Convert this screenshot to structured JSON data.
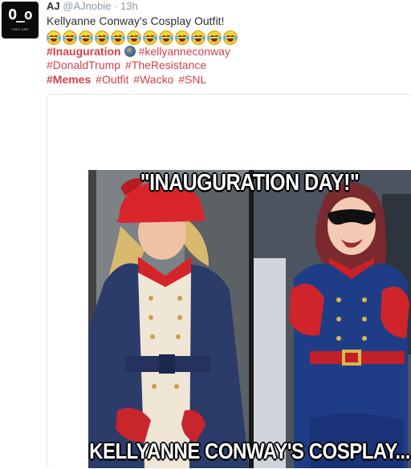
{
  "user": {
    "name": "AJ",
    "handle": "@AJnobie",
    "separator": "·",
    "time": "13h",
    "avatar": {
      "face": "O_o",
      "tiny_text": "THEY ARE"
    }
  },
  "tweet": {
    "text": "Kellyanne Conway's Cosplay Outfit!",
    "emoji_count": 12,
    "emoji_name": "face-with-tears-of-joy",
    "hashtag_lines": [
      [
        {
          "text": "#Inauguration",
          "bold": true
        },
        {
          "text": "#kellyanneconway",
          "bold": false
        }
      ],
      [
        {
          "text": "#DonaldTrump",
          "bold": false
        },
        {
          "text": "#TheResistance",
          "bold": false
        }
      ],
      [
        {
          "text": "#Memes",
          "bold": true
        },
        {
          "text": "#Outfit",
          "bold": false
        },
        {
          "text": "#Wacko",
          "bold": false
        },
        {
          "text": "#SNL",
          "bold": false
        }
      ]
    ]
  },
  "meme": {
    "top_caption": "\"INAUGURATION DAY!\"",
    "bottom_caption": "KELLYANNE CONWAY'S COSPLAY..."
  },
  "colors": {
    "hashtag": "#d1424a",
    "name": "#292f33",
    "meta": "#8899a6",
    "card_border": "#e1e8ed"
  }
}
